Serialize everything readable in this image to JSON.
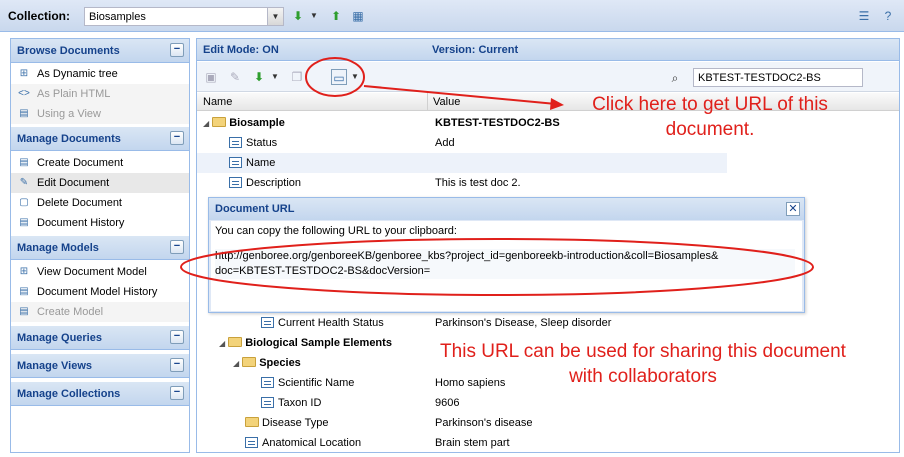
{
  "collection": {
    "label": "Collection:",
    "selected": "Biosamples"
  },
  "sidebar": {
    "sections": [
      {
        "title": "Browse Documents",
        "items": [
          {
            "label": "As Dynamic tree",
            "icon": "tree-icon",
            "enabled": true
          },
          {
            "label": "As Plain HTML",
            "icon": "html-icon",
            "enabled": false
          },
          {
            "label": "Using a View",
            "icon": "view-icon",
            "enabled": false
          }
        ]
      },
      {
        "title": "Manage Documents",
        "items": [
          {
            "label": "Create Document",
            "icon": "document-icon",
            "enabled": true
          },
          {
            "label": "Edit Document",
            "icon": "edit-icon",
            "enabled": true,
            "selected": true
          },
          {
            "label": "Delete Document",
            "icon": "delete-icon",
            "enabled": true
          },
          {
            "label": "Document History",
            "icon": "history-icon",
            "enabled": true
          }
        ]
      },
      {
        "title": "Manage Models",
        "items": [
          {
            "label": "View Document Model",
            "icon": "tree-icon",
            "enabled": true
          },
          {
            "label": "Document Model History",
            "icon": "history-icon",
            "enabled": true
          },
          {
            "label": "Create Model",
            "icon": "document-icon",
            "enabled": false
          }
        ]
      },
      {
        "title": "Manage Queries",
        "items": []
      },
      {
        "title": "Manage Views",
        "items": []
      },
      {
        "title": "Manage Collections",
        "items": []
      }
    ]
  },
  "main": {
    "edit_mode": "Edit Mode: ON",
    "version": "Version: Current",
    "search_value": "KBTEST-TESTDOC2-BS",
    "columns": [
      "Name",
      "Value"
    ]
  },
  "rows": [
    {
      "name": "Biosample",
      "value": "KBTEST-TESTDOC2-BS",
      "type": "folder",
      "bold": true
    },
    {
      "name": "Status",
      "value": "Add",
      "type": "leaf"
    },
    {
      "name": "Name",
      "value": "",
      "type": "leaf"
    },
    {
      "name": "Description",
      "value": "This is test doc 2.",
      "type": "leaf"
    },
    {
      "name": "Current Health Status",
      "value": "Parkinson's Disease, Sleep disorder",
      "type": "leaf"
    },
    {
      "name": "Biological Sample Elements",
      "value": "",
      "type": "folder",
      "bold": true
    },
    {
      "name": "Species",
      "value": "",
      "type": "folder",
      "bold": true
    },
    {
      "name": "Scientific Name",
      "value": "Homo sapiens",
      "type": "leaf"
    },
    {
      "name": "Taxon ID",
      "value": "9606",
      "type": "leaf"
    },
    {
      "name": "Disease Type",
      "value": "Parkinson's disease",
      "type": "folder"
    },
    {
      "name": "Anatomical Location",
      "value": "Brain stem part",
      "type": "leaf"
    }
  ],
  "dialog": {
    "title": "Document URL",
    "message": "You can copy the following URL to your clipboard:",
    "url_line1": "http://genboree.org/genboreeKB/genboree_kbs?project_id=genboreekb-introduction&coll=Biosamples&",
    "url_line2": "doc=KBTEST-TESTDOC2-BS&docVersion="
  },
  "annotations": {
    "url_button": [
      "Click here to get URL of this",
      "document."
    ],
    "sharing": [
      "This URL can be used for sharing this document",
      "with collaborators"
    ],
    "color": "#e0201b"
  }
}
